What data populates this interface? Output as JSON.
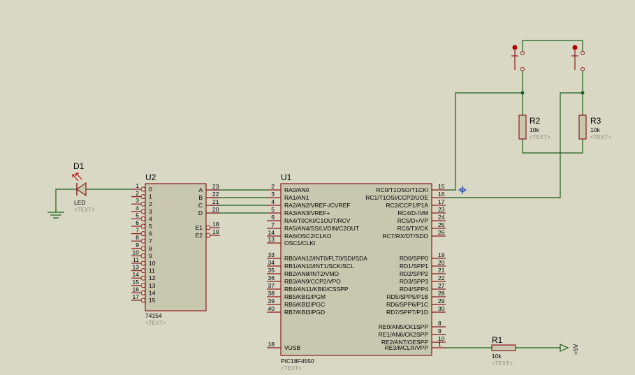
{
  "colors": {
    "background": "#d8d8c4",
    "wire": "#1a5e1a",
    "body_fill": "#c8c8b0",
    "body_stroke": "#8b1a1a",
    "pin": "#8b1a1a",
    "junction": "#1a5e1a",
    "button_red": "#b00000",
    "marker_blue": "#1a3aa8"
  },
  "components": {
    "d1": {
      "ref": "D1",
      "value": "LED",
      "placeholder": "<TEXT>"
    },
    "u2": {
      "ref": "U2",
      "part": "74154",
      "placeholder": "<TEXT>",
      "left_pins": [
        {
          "num": "1",
          "name": "0"
        },
        {
          "num": "2",
          "name": "1"
        },
        {
          "num": "3",
          "name": "2"
        },
        {
          "num": "4",
          "name": "3"
        },
        {
          "num": "5",
          "name": "4"
        },
        {
          "num": "6",
          "name": "5"
        },
        {
          "num": "7",
          "name": "6"
        },
        {
          "num": "8",
          "name": "7"
        },
        {
          "num": "9",
          "name": "8"
        },
        {
          "num": "10",
          "name": "9"
        },
        {
          "num": "11",
          "name": "10"
        },
        {
          "num": "13",
          "name": "11"
        },
        {
          "num": "14",
          "name": "12"
        },
        {
          "num": "15",
          "name": "13"
        },
        {
          "num": "16",
          "name": "14"
        },
        {
          "num": "17",
          "name": "15"
        }
      ],
      "right_pins": [
        {
          "num": "23",
          "name": "A"
        },
        {
          "num": "22",
          "name": "B"
        },
        {
          "num": "21",
          "name": "C"
        },
        {
          "num": "20",
          "name": "D"
        },
        {
          "num": "18",
          "name": "E1"
        },
        {
          "num": "19",
          "name": "E2"
        }
      ]
    },
    "u1": {
      "ref": "U1",
      "part": "PIC18F4550",
      "placeholder": "<TEXT>",
      "left_pins": [
        {
          "num": "2",
          "name": "RA0/AN0"
        },
        {
          "num": "3",
          "name": "RA1/AN1"
        },
        {
          "num": "4",
          "name": "RA2/AN2/VREF-/CVREF"
        },
        {
          "num": "5",
          "name": "RA3/AN3/VREF+"
        },
        {
          "num": "6",
          "name": "RA4/T0CKI/C1OUT/RCV"
        },
        {
          "num": "7",
          "name": "RA5/AN4/SS/LVDIN/C2OUT"
        },
        {
          "num": "14",
          "name": "RA6/OSC2/CLKO"
        },
        {
          "num": "13",
          "name": "OSC1/CLKI"
        },
        {
          "num": "33",
          "name": "RB0/AN12/INT0/FLT0/SDI/SDA"
        },
        {
          "num": "34",
          "name": "RB1/AN10/INT1/SCK/SCL"
        },
        {
          "num": "35",
          "name": "RB2/AN8/INT2/VMO"
        },
        {
          "num": "36",
          "name": "RB3/AN9/CCP2/VPO"
        },
        {
          "num": "37",
          "name": "RB4/AN11/KBI0/CSSPP"
        },
        {
          "num": "38",
          "name": "RB5/KBI1/PGM"
        },
        {
          "num": "39",
          "name": "RB6/KBI2/PGC"
        },
        {
          "num": "40",
          "name": "RB7/KBI3/PGD"
        },
        {
          "num": "18",
          "name": "VUSB"
        }
      ],
      "right_pins": [
        {
          "num": "15",
          "name": "RC0/T1OSO/T1CKI"
        },
        {
          "num": "16",
          "name": "RC1/T1OSI/CCP2/UOE"
        },
        {
          "num": "17",
          "name": "RC2/CCP1/P1A"
        },
        {
          "num": "23",
          "name": "RC4/D-/VM"
        },
        {
          "num": "24",
          "name": "RC5/D+/VP"
        },
        {
          "num": "25",
          "name": "RC6/TX/CK"
        },
        {
          "num": "26",
          "name": "RC7/RX/DT/SDO"
        },
        {
          "num": "19",
          "name": "RD0/SPP0"
        },
        {
          "num": "20",
          "name": "RD1/SPP1"
        },
        {
          "num": "21",
          "name": "RD2/SPP2"
        },
        {
          "num": "22",
          "name": "RD3/SPP3"
        },
        {
          "num": "27",
          "name": "RD4/SPP4"
        },
        {
          "num": "28",
          "name": "RD5/SPP5/P1B"
        },
        {
          "num": "29",
          "name": "RD6/SPP6/P1C"
        },
        {
          "num": "30",
          "name": "RD7/SPP7/P1D"
        },
        {
          "num": "8",
          "name": "RE0/AN5/CK1SPP"
        },
        {
          "num": "9",
          "name": "RE1/AN6/CK2SPP"
        },
        {
          "num": "10",
          "name": "RE2/AN7/OESPP"
        },
        {
          "num": "1",
          "name": "RE3/MCLR/VPP"
        }
      ]
    },
    "r1": {
      "ref": "R1",
      "value": "10k",
      "placeholder": "<TEXT>"
    },
    "r2": {
      "ref": "R2",
      "value": "10k",
      "placeholder": "<TEXT>"
    },
    "r3": {
      "ref": "R3",
      "value": "10k",
      "placeholder": "<TEXT>"
    },
    "supply": {
      "label": "+5V"
    }
  }
}
